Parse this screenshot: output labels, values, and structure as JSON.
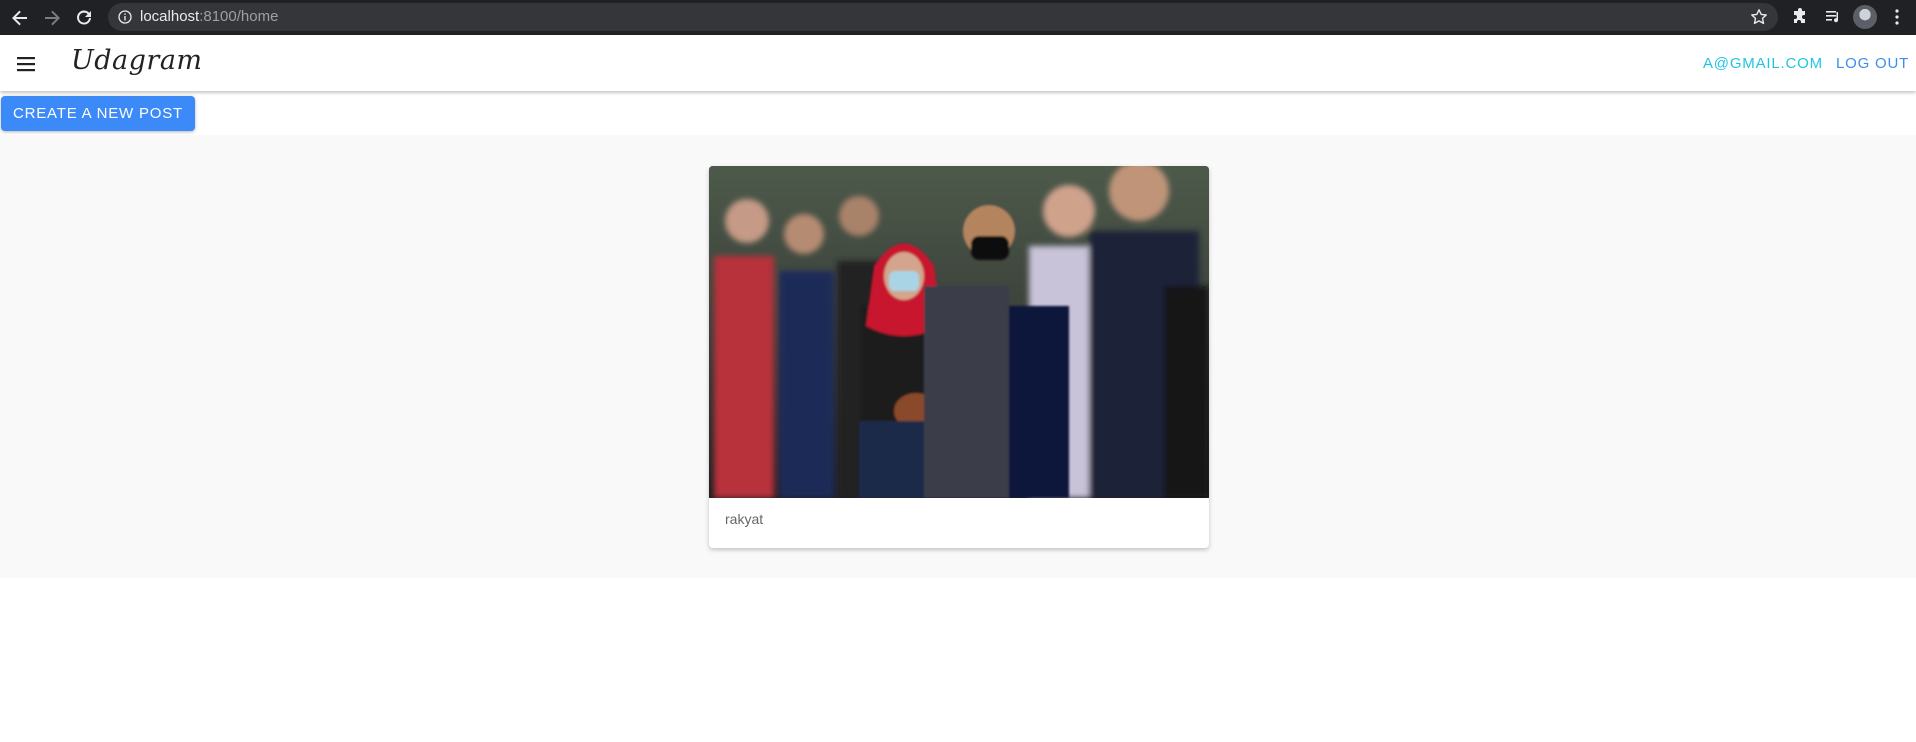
{
  "browser": {
    "url_host": "localhost",
    "url_rest": ":8100/home"
  },
  "toolbar": {
    "brand": "Udagram",
    "user_email": "A@GMAIL.COM",
    "logout_label": "LOG OUT"
  },
  "actions": {
    "create_post_label": "CREATE A NEW POST"
  },
  "feed": {
    "posts": [
      {
        "caption": "rakyat",
        "image_alt": "crowd of people wearing face masks"
      }
    ]
  },
  "colors": {
    "primary": "#3c8af7",
    "email_link": "#21c4e0",
    "logout_link": "#3b8ef0",
    "chrome_bg": "#202124",
    "feed_bg": "#f9f9f9"
  },
  "icons": [
    "back-arrow-icon",
    "forward-arrow-icon",
    "reload-icon",
    "info-icon",
    "star-icon",
    "extensions-icon",
    "media-queue-icon",
    "profile-avatar",
    "kebab-menu-icon",
    "hamburger-menu-icon"
  ]
}
